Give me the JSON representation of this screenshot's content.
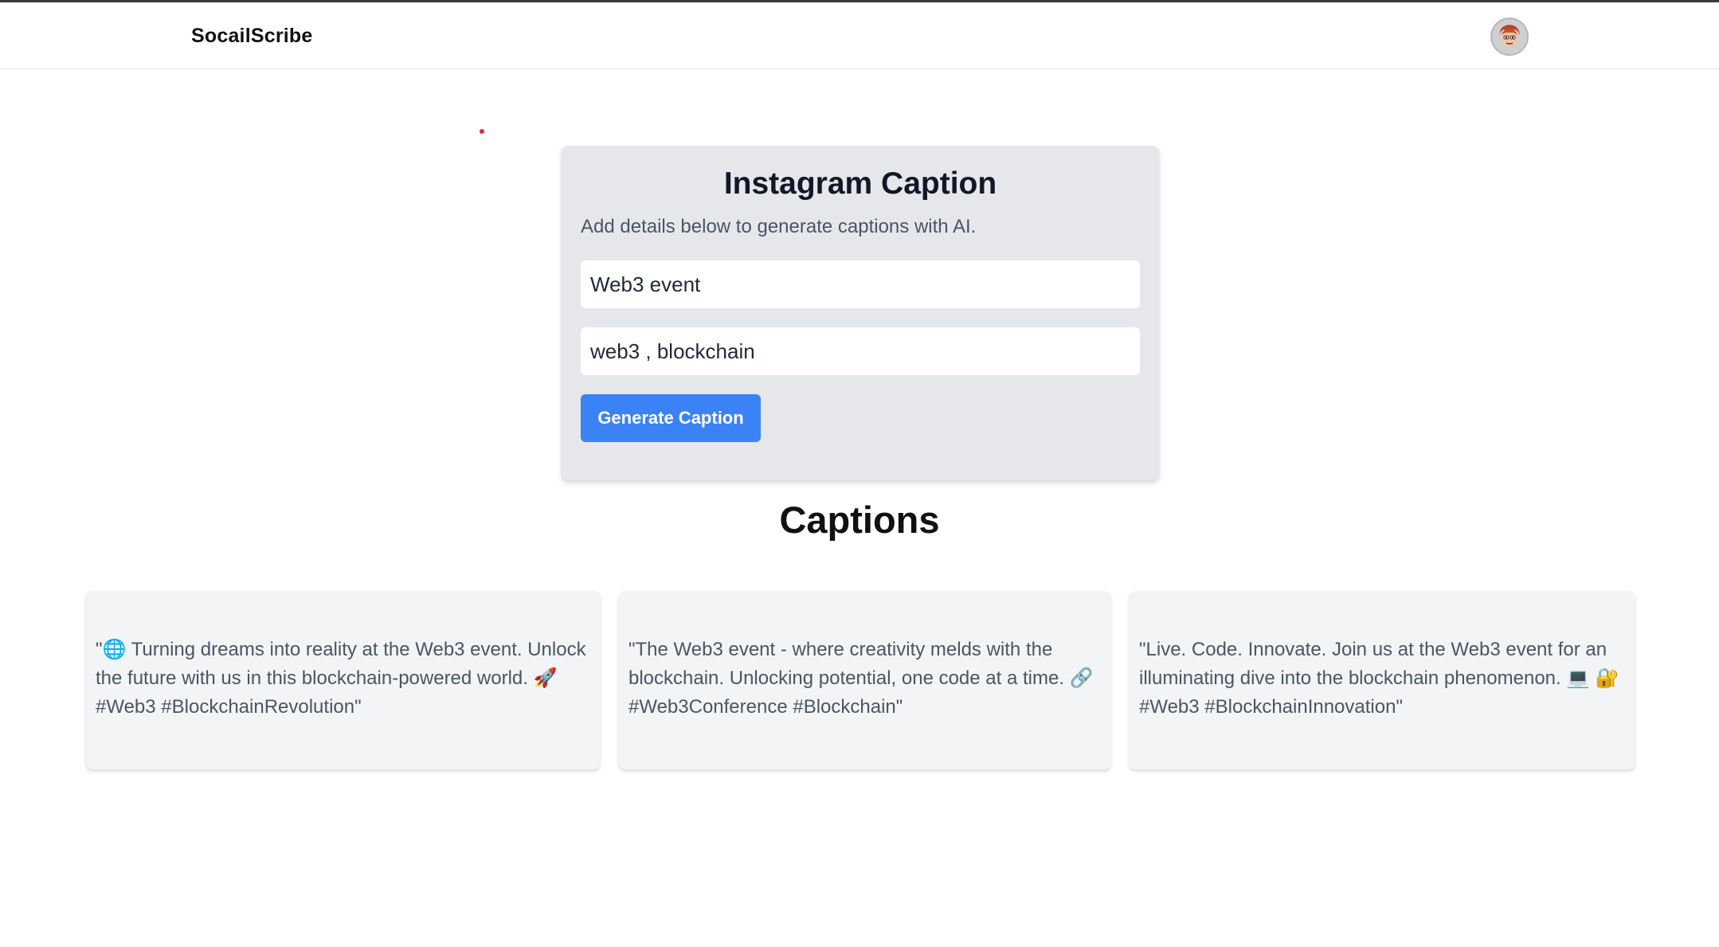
{
  "app": {
    "brand": "SocailScribe"
  },
  "form": {
    "title": "Instagram Caption",
    "subtitle": "Add details below to generate captions with AI.",
    "topic_value": "Web3 event",
    "keywords_value": "web3 , blockchain",
    "submit_label": "Generate Caption"
  },
  "captions": {
    "heading": "Captions",
    "items": [
      {
        "text": "\"🌐 Turning dreams into reality at the Web3 event. Unlock the future with us in this blockchain-powered world. 🚀 #Web3 #BlockchainRevolution\""
      },
      {
        "text": "\"The Web3 event - where creativity melds with the blockchain. Unlocking potential, one code at a time. 🔗 #Web3Conference #Blockchain\""
      },
      {
        "text": "\"Live. Code. Innovate. Join us at the Web3 event for an illuminating dive into the blockchain phenomenon. 💻 🔐 #Web3 #BlockchainInnovation\""
      }
    ]
  },
  "colors": {
    "primary_button": "#3b82f6",
    "card_background": "#e5e7eb",
    "caption_card_background": "#f3f4f6"
  },
  "icons": {
    "avatar": "user-avatar-icon"
  }
}
